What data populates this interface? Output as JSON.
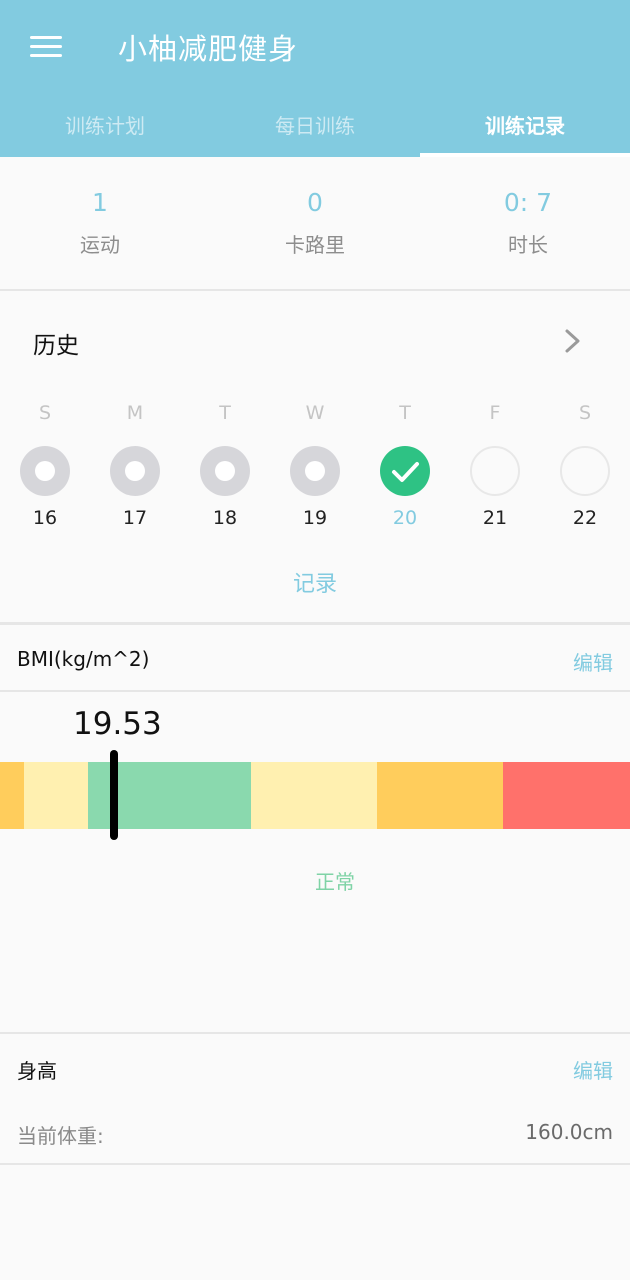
{
  "app": {
    "title": "小柚减肥健身"
  },
  "tabs": [
    {
      "label": "训练计划"
    },
    {
      "label": "每日训练"
    },
    {
      "label": "训练记录"
    }
  ],
  "stats": [
    {
      "value": "1",
      "label": "运动"
    },
    {
      "value": "0",
      "label": "卡路里"
    },
    {
      "value": "0: 7",
      "label": "时长"
    }
  ],
  "history": {
    "title": "历史",
    "days": [
      {
        "letter": "S",
        "date": "16",
        "state": "done"
      },
      {
        "letter": "M",
        "date": "17",
        "state": "done"
      },
      {
        "letter": "T",
        "date": "18",
        "state": "done"
      },
      {
        "letter": "W",
        "date": "19",
        "state": "done"
      },
      {
        "letter": "T",
        "date": "20",
        "state": "today"
      },
      {
        "letter": "F",
        "date": "21",
        "state": "future"
      },
      {
        "letter": "S",
        "date": "22",
        "state": "future"
      }
    ],
    "record_label": "记录"
  },
  "bmi": {
    "title": "BMI(kg/m^2)",
    "edit_label": "编辑",
    "value": "19.53",
    "status": "正常",
    "segments": [
      "#ffcd5c",
      "#fff0b0",
      "#8ad9ae",
      "#fff0b0",
      "#ffcd5c",
      "#ff716b"
    ]
  },
  "height": {
    "title": "身高",
    "edit_label": "编辑",
    "weight_label": "当前体重:",
    "weight_value": "160.0cm"
  },
  "colors": {
    "primary": "#82cbe0",
    "success": "#2ec284"
  }
}
